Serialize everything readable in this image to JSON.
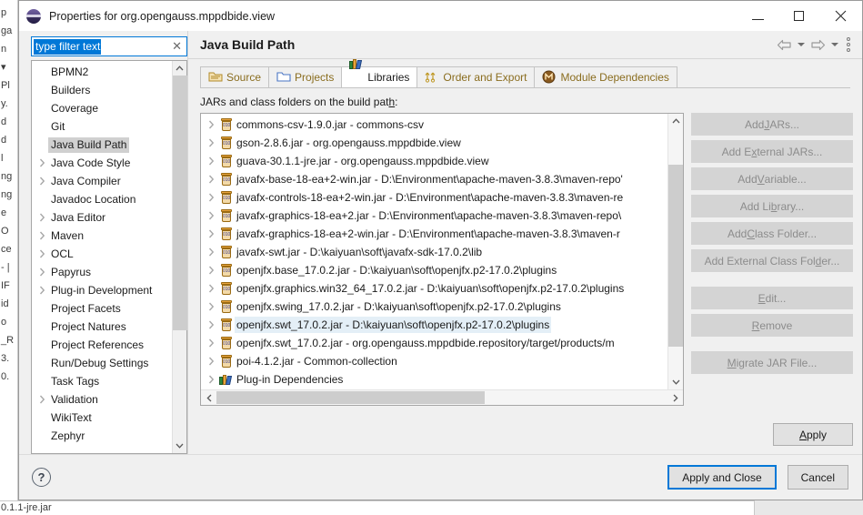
{
  "background": {
    "edge_fragments": [
      "p",
      "ga",
      "n",
      "▾",
      "Pl",
      "y.",
      "d",
      "d",
      "l",
      "ng",
      "ng",
      "e",
      "O",
      "ce",
      "- |",
      "IF",
      "id",
      "o",
      "_R",
      "3.",
      "0."
    ],
    "bottom_text": "0.1.1-jre.jar"
  },
  "window": {
    "title": "Properties for org.opengauss.mppdbide.view",
    "icon": "eclipse-icon",
    "controls": {
      "minimize": "minimize-button",
      "maximize": "maximize-button",
      "close": "close-button"
    }
  },
  "filter": {
    "value": "type filter text",
    "placeholder": "type filter text",
    "clear_label": "✕"
  },
  "tree": {
    "items": [
      {
        "label": "BPMN2",
        "expandable": false,
        "selected": false
      },
      {
        "label": "Builders",
        "expandable": false,
        "selected": false
      },
      {
        "label": "Coverage",
        "expandable": false,
        "selected": false
      },
      {
        "label": "Git",
        "expandable": false,
        "selected": false
      },
      {
        "label": "Java Build Path",
        "expandable": false,
        "selected": true
      },
      {
        "label": "Java Code Style",
        "expandable": true,
        "selected": false
      },
      {
        "label": "Java Compiler",
        "expandable": true,
        "selected": false
      },
      {
        "label": "Javadoc Location",
        "expandable": false,
        "selected": false
      },
      {
        "label": "Java Editor",
        "expandable": true,
        "selected": false
      },
      {
        "label": "Maven",
        "expandable": true,
        "selected": false
      },
      {
        "label": "OCL",
        "expandable": true,
        "selected": false
      },
      {
        "label": "Papyrus",
        "expandable": true,
        "selected": false
      },
      {
        "label": "Plug-in Development",
        "expandable": true,
        "selected": false
      },
      {
        "label": "Project Facets",
        "expandable": false,
        "selected": false
      },
      {
        "label": "Project Natures",
        "expandable": false,
        "selected": false
      },
      {
        "label": "Project References",
        "expandable": false,
        "selected": false
      },
      {
        "label": "Run/Debug Settings",
        "expandable": false,
        "selected": false
      },
      {
        "label": "Task Tags",
        "expandable": false,
        "selected": false
      },
      {
        "label": "Validation",
        "expandable": true,
        "selected": false
      },
      {
        "label": "WikiText",
        "expandable": false,
        "selected": false
      },
      {
        "label": "Zephyr",
        "expandable": false,
        "selected": false
      }
    ]
  },
  "page": {
    "title": "Java Build Path",
    "nav": {
      "back": "back-arrow",
      "forward": "forward-arrow",
      "menu": "view-menu"
    }
  },
  "tabs": [
    {
      "label": "Source",
      "icon": "source-folder-icon",
      "active": false
    },
    {
      "label": "Projects",
      "icon": "projects-folder-icon",
      "active": false
    },
    {
      "label": "Libraries",
      "icon": "libraries-books-icon",
      "active": true
    },
    {
      "label": "Order and Export",
      "icon": "order-export-icon",
      "active": false
    },
    {
      "label": "Module Dependencies",
      "icon": "module-dependencies-icon",
      "active": false
    }
  ],
  "list": {
    "caption_pre": "JARs and class folders on the build pat",
    "caption_mnemonic": "h",
    "caption_post": ":",
    "rows": [
      {
        "text": "commons-csv-1.9.0.jar - commons-csv",
        "icon": "jar-icon",
        "selected": false
      },
      {
        "text": "gson-2.8.6.jar - org.opengauss.mppdbide.view",
        "icon": "jar-icon",
        "selected": false
      },
      {
        "text": "guava-30.1.1-jre.jar - org.opengauss.mppdbide.view",
        "icon": "jar-icon",
        "selected": false
      },
      {
        "text": "javafx-base-18-ea+2-win.jar - D:\\Environment\\apache-maven-3.8.3\\maven-repo'",
        "icon": "jar-icon",
        "selected": false
      },
      {
        "text": "javafx-controls-18-ea+2-win.jar - D:\\Environment\\apache-maven-3.8.3\\maven-re",
        "icon": "jar-icon",
        "selected": false
      },
      {
        "text": "javafx-graphics-18-ea+2.jar - D:\\Environment\\apache-maven-3.8.3\\maven-repo\\",
        "icon": "jar-icon",
        "selected": false
      },
      {
        "text": "javafx-graphics-18-ea+2-win.jar - D:\\Environment\\apache-maven-3.8.3\\maven-r",
        "icon": "jar-icon",
        "selected": false
      },
      {
        "text": "javafx-swt.jar - D:\\kaiyuan\\soft\\javafx-sdk-17.0.2\\lib",
        "icon": "jar-icon",
        "selected": false
      },
      {
        "text": "openjfx.base_17.0.2.jar - D:\\kaiyuan\\soft\\openjfx.p2-17.0.2\\plugins",
        "icon": "jar-icon",
        "selected": false
      },
      {
        "text": "openjfx.graphics.win32_64_17.0.2.jar - D:\\kaiyuan\\soft\\openjfx.p2-17.0.2\\plugins",
        "icon": "jar-icon",
        "selected": false
      },
      {
        "text": "openjfx.swing_17.0.2.jar - D:\\kaiyuan\\soft\\openjfx.p2-17.0.2\\plugins",
        "icon": "jar-icon",
        "selected": false
      },
      {
        "text": "openjfx.swt_17.0.2.jar - D:\\kaiyuan\\soft\\openjfx.p2-17.0.2\\plugins",
        "icon": "jar-icon",
        "selected": true
      },
      {
        "text": "openjfx.swt_17.0.2.jar - org.opengauss.mppdbide.repository/target/products/m",
        "icon": "jar-icon",
        "selected": false
      },
      {
        "text": "poi-4.1.2.jar - Common-collection",
        "icon": "jar-icon",
        "selected": false
      },
      {
        "text": "Plug-in Dependencies",
        "icon": "libraries-books-icon",
        "selected": false
      }
    ]
  },
  "side_buttons": [
    {
      "pre": "Add ",
      "mnemonic": "J",
      "post": "ARs...",
      "enabled": false
    },
    {
      "pre": "Add E",
      "mnemonic": "x",
      "post": "ternal JARs...",
      "enabled": false
    },
    {
      "pre": "Add ",
      "mnemonic": "V",
      "post": "ariable...",
      "enabled": false
    },
    {
      "pre": "Add Li",
      "mnemonic": "b",
      "post": "rary...",
      "enabled": false
    },
    {
      "pre": "Add ",
      "mnemonic": "C",
      "post": "lass Folder...",
      "enabled": false
    },
    {
      "pre": "Add External Class Fol",
      "mnemonic": "d",
      "post": "er...",
      "enabled": false
    },
    {
      "pre": "",
      "mnemonic": "E",
      "post": "dit...",
      "enabled": false,
      "gap_before": true
    },
    {
      "pre": "",
      "mnemonic": "R",
      "post": "emove",
      "enabled": false
    },
    {
      "pre": "",
      "mnemonic": "M",
      "post": "igrate JAR File...",
      "enabled": false,
      "gap_before": true
    }
  ],
  "apply": {
    "pre": "",
    "mnemonic": "A",
    "post": "pply"
  },
  "footer": {
    "help": "?",
    "apply_and_close": "Apply and Close",
    "cancel": "Cancel"
  }
}
